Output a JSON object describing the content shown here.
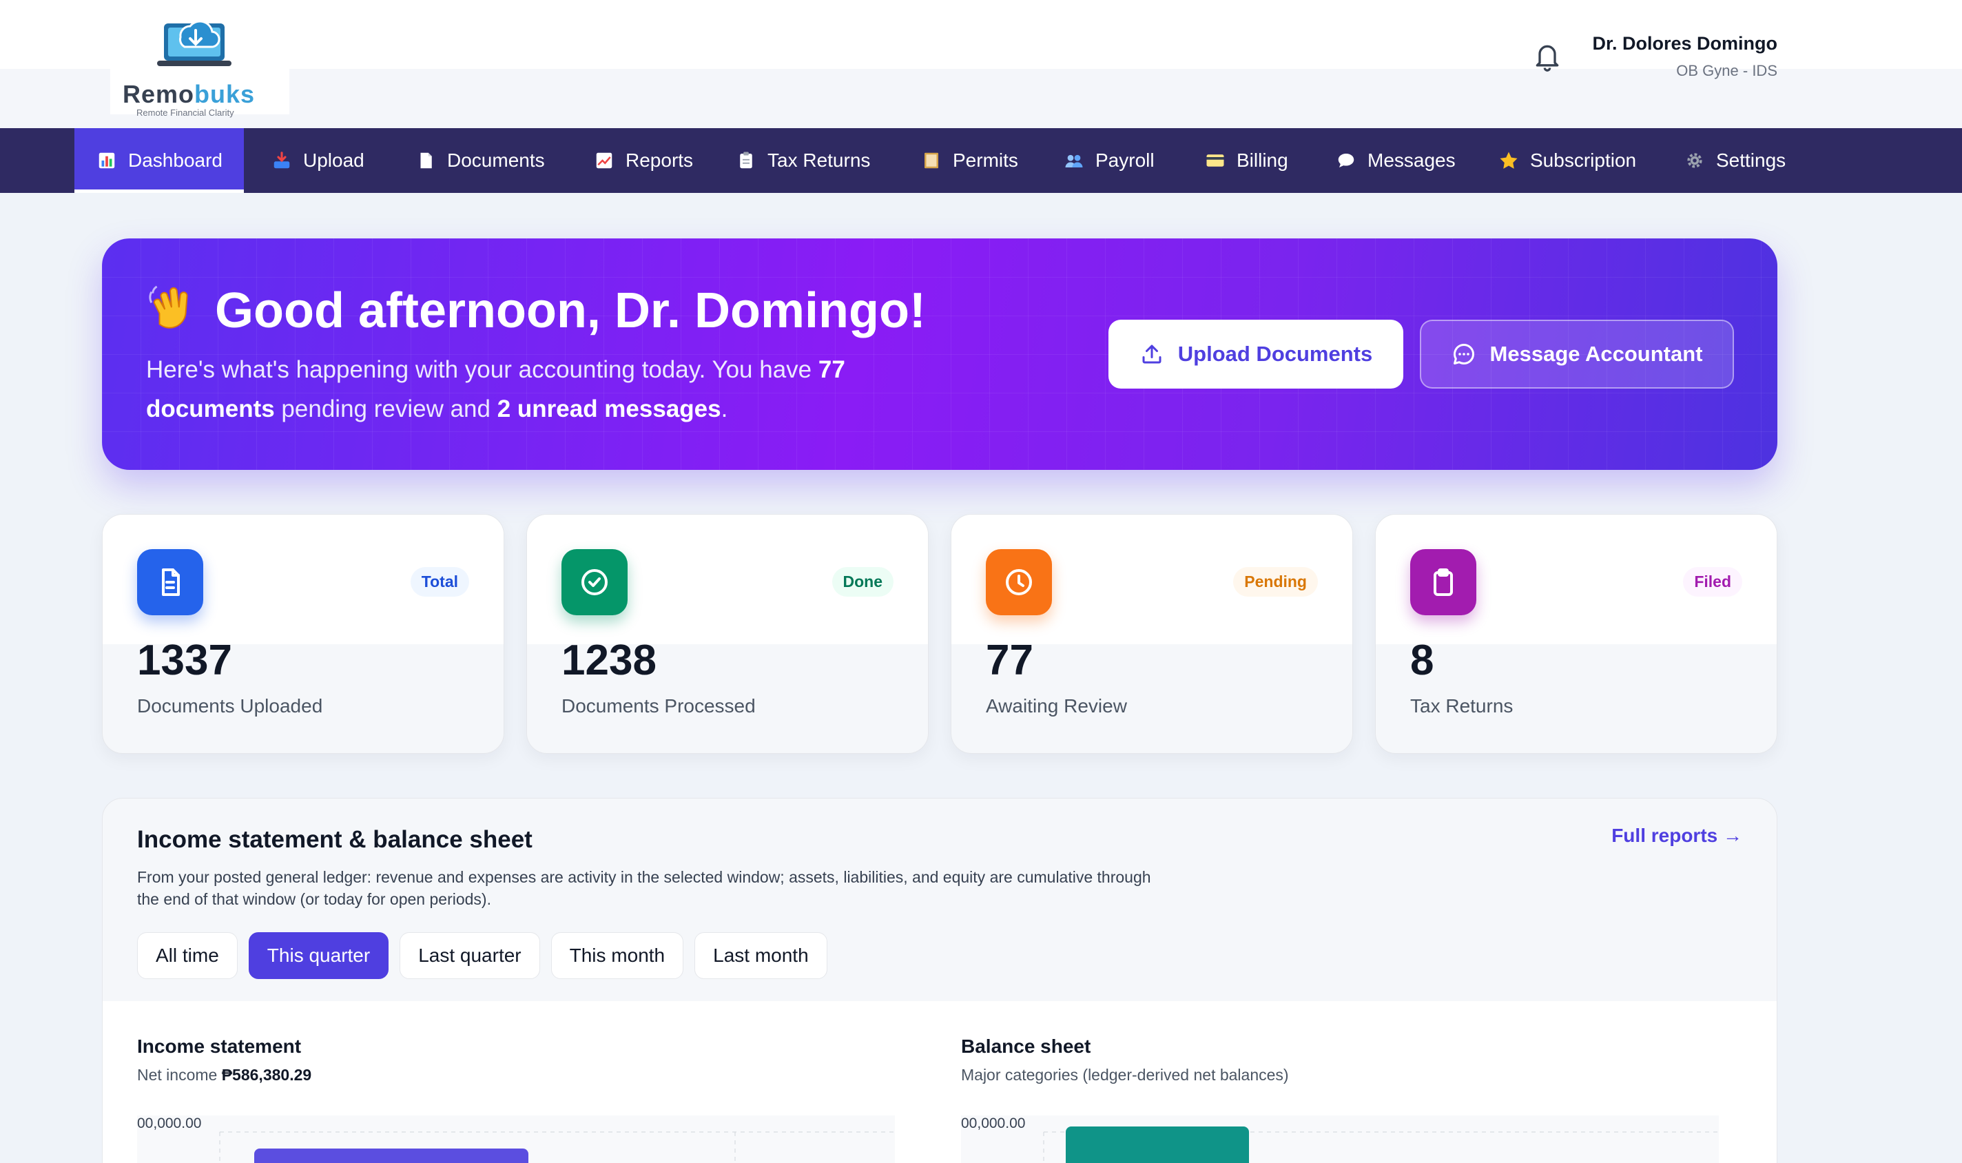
{
  "brand": {
    "name_a": "Remo",
    "name_b": "buks",
    "tagline": "Remote Financial Clarity"
  },
  "user": {
    "name": "Dr. Dolores Domingo",
    "role": "OB Gyne - IDS"
  },
  "nav": {
    "items": [
      {
        "label": "Dashboard",
        "icon": "chart-icon",
        "active": true
      },
      {
        "label": "Upload",
        "icon": "inbox-tray-icon",
        "active": false
      },
      {
        "label": "Documents",
        "icon": "page-icon",
        "active": false
      },
      {
        "label": "Reports",
        "icon": "chart-increasing-icon",
        "active": false
      },
      {
        "label": "Tax Returns",
        "icon": "clipboard-icon",
        "active": false
      },
      {
        "label": "Permits",
        "icon": "ledger-icon",
        "active": false
      },
      {
        "label": "Payroll",
        "icon": "people-icon",
        "active": false
      },
      {
        "label": "Billing",
        "icon": "credit-card-icon",
        "active": false
      },
      {
        "label": "Messages",
        "icon": "speech-bubble-icon",
        "active": false
      },
      {
        "label": "Subscription",
        "icon": "star-icon",
        "active": false
      },
      {
        "label": "Settings",
        "icon": "gear-icon",
        "active": false
      }
    ]
  },
  "hero": {
    "title": "Good afternoon, Dr. Domingo!",
    "sub_a": "Here's what's happening with your accounting today. You have ",
    "sub_b": "77 documents",
    "sub_c": " pending review and ",
    "sub_d": "2 unread messages",
    "sub_e": ".",
    "upload_label": "Upload Documents",
    "message_label": "Message Accountant"
  },
  "stats": [
    {
      "value": "1337",
      "label": "Documents Uploaded",
      "badge": "Total",
      "color": "#2563eb",
      "badge_bg": "#eff6ff",
      "badge_color": "#1d4ed8",
      "icon": "document-icon"
    },
    {
      "value": "1238",
      "label": "Documents Processed",
      "badge": "Done",
      "color": "#059669",
      "badge_bg": "#ecfdf5",
      "badge_color": "#047857",
      "icon": "check-circle-icon"
    },
    {
      "value": "77",
      "label": "Awaiting Review",
      "badge": "Pending",
      "color": "#f97316",
      "badge_bg": "#fff7ed",
      "badge_color": "#d97706",
      "icon": "clock-icon"
    },
    {
      "value": "8",
      "label": "Tax Returns",
      "badge": "Filed",
      "color": "#a21caf",
      "badge_bg": "#fdf4ff",
      "badge_color": "#a21caf",
      "icon": "clipboard-icon"
    }
  ],
  "financials": {
    "title": "Income statement & balance sheet",
    "link": "Full reports →",
    "description": "From your posted general ledger: revenue and expenses are activity in the selected window; assets, liabilities, and equity are cumulative through the end of that window (or today for open periods).",
    "tabs": [
      "All time",
      "This quarter",
      "Last quarter",
      "This month",
      "Last month"
    ],
    "active_tab": 1,
    "income": {
      "title": "Income statement",
      "net_label": "Net income ",
      "net_value": "₱586,380.29",
      "tick": "00,000.00"
    },
    "balance": {
      "title": "Balance sheet",
      "sub": "Major categories (ledger-derived net balances)",
      "tick": "00,000.00"
    }
  },
  "colors": {
    "accent": "#4f3fe0",
    "nav_bg": "#2f2a62",
    "income_bar": "#5b4ee0",
    "balance_bar": "#0f9488"
  }
}
